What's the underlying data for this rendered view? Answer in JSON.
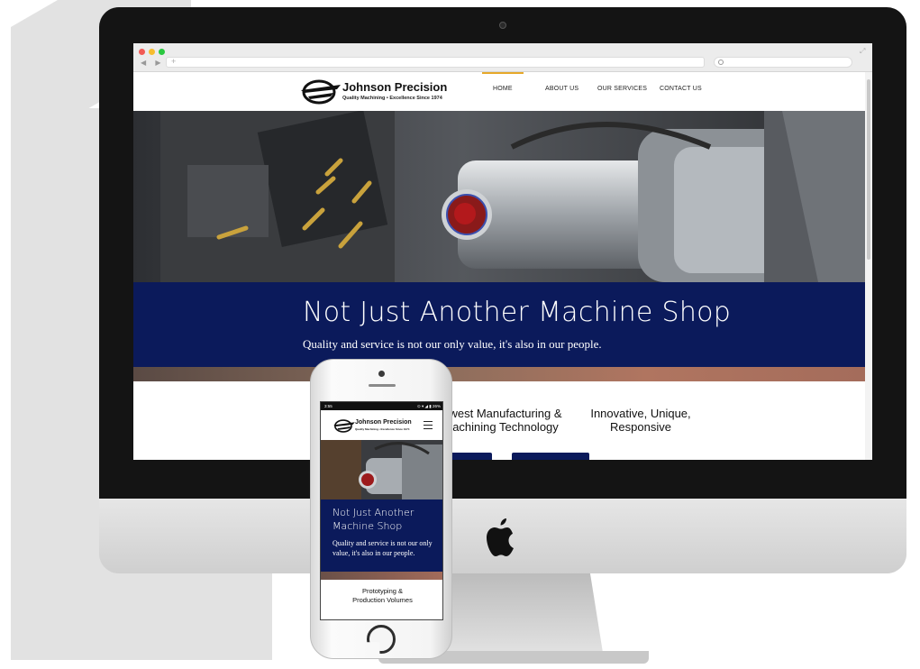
{
  "site": {
    "logo_name": "Johnson Precision",
    "logo_tagline": "Quality Machining • Excellence Since 1974",
    "nav": [
      "HOME",
      "ABOUT US",
      "OUR SERVICES",
      "CONTACT US"
    ],
    "hero_title": "Not Just Another Machine Shop",
    "hero_subtitle": "Quality and service is not our only value, it's also in our people.",
    "features": [
      "west Manufacturing &\nachining Technology",
      "Innovative, Unique,\nResponsive"
    ]
  },
  "mobile": {
    "status_time": "3:55",
    "status_right": "⊙ ▾ ◢ ▮ 26%",
    "logo_name": "Johnson Precision",
    "logo_tagline": "Quality Machining • Excellence Since 1974",
    "hero_title": "Not Just Another Machine Shop",
    "hero_subtitle": "Quality and service is not our only value, it's also in our people.",
    "feature": "Prototyping &\nProduction Volumes"
  },
  "colors": {
    "navy": "#0b1a5b",
    "accent": "#e6a82a",
    "bezel": "#141414"
  },
  "icons": [
    "apple-logo-icon",
    "search-icon",
    "menu-icon",
    "camera-icon"
  ]
}
